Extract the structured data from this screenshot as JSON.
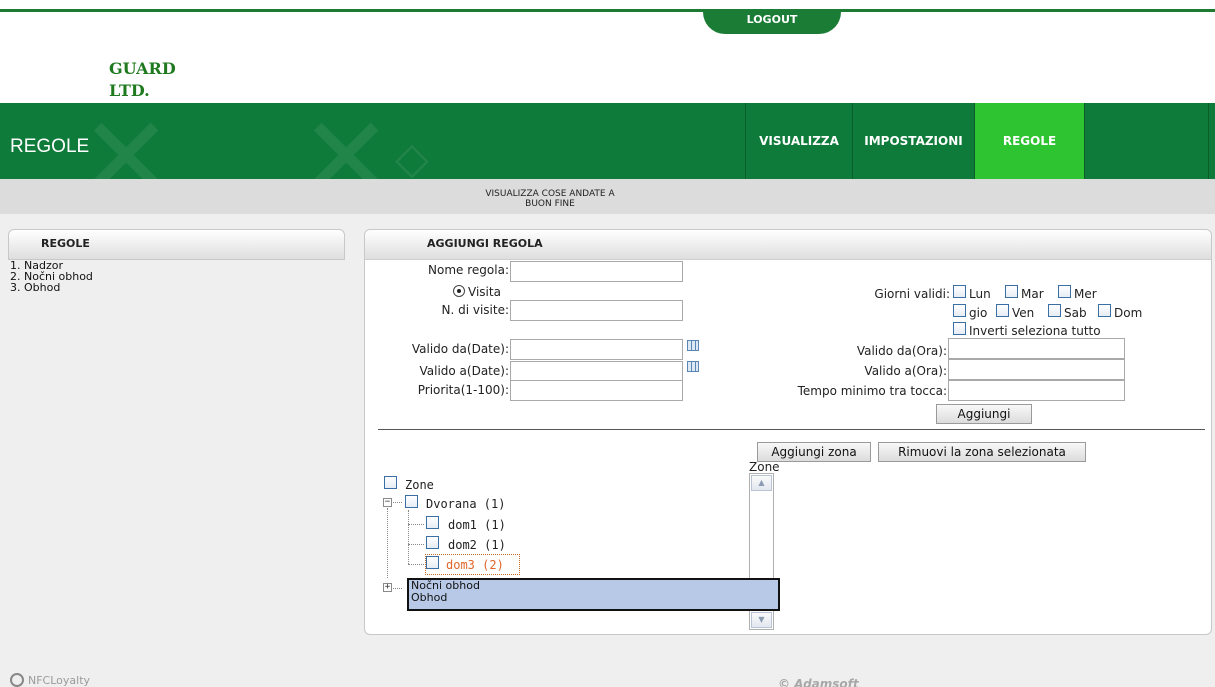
{
  "header": {
    "logout_label": "LOGOUT",
    "logo_line1": "GUARD",
    "logo_line2": "LTD."
  },
  "banner": {
    "title": "REGOLE",
    "nav": [
      {
        "label": "VISUALIZZA",
        "active": false
      },
      {
        "label": "IMPOSTAZIONI",
        "active": false
      },
      {
        "label": "REGOLE",
        "active": true
      }
    ],
    "accent_color": "#0f7b3a",
    "active_color": "#2ec331"
  },
  "strip": {
    "line1": "VISUALIZZA COSE ANDATE A",
    "line2": "BUON FINE"
  },
  "sidebar": {
    "title": "REGOLE",
    "items": [
      "1. Nadzor",
      "2. Nočni obhod",
      "3. Obhod"
    ]
  },
  "form": {
    "title": "AGGIUNGI REGOLA",
    "nome_regola_label": "Nome regola:",
    "nome_regola_value": "",
    "radio_label": "Visita",
    "n_visite_label": "N. di visite:",
    "valido_da_date_label": "Valido da(Date):",
    "valido_a_date_label": "Valido a(Date):",
    "priorita_label": "Priorita(1-100):",
    "giorni_label": "Giorni validi:",
    "days": [
      "Lun",
      "Mar",
      "Mer",
      "gio",
      "Ven",
      "Sab",
      "Dom"
    ],
    "inverti_label": "Inverti seleziona tutto",
    "valido_da_ora_label": "Valido da(Ora):",
    "valido_a_ora_label": "Valido a(Ora):",
    "tempo_label": "Tempo minimo tra tocca:",
    "aggiungi_label": "Aggiungi"
  },
  "zones": {
    "add_zone_label": "Aggiungi zona",
    "remove_zone_label": "Rimuovi la zona selezionata",
    "list_title": "Zone",
    "tree": {
      "root": "Zone",
      "group": "Dvorana (1)",
      "children": [
        "dom1 (1)",
        "dom2 (1)",
        "dom3 (2)"
      ]
    },
    "dropdown_options": [
      "Nočni obhod",
      "Obhod"
    ]
  },
  "footer": {
    "left": "NFCLoyalty",
    "right": "© Adamsoft"
  }
}
